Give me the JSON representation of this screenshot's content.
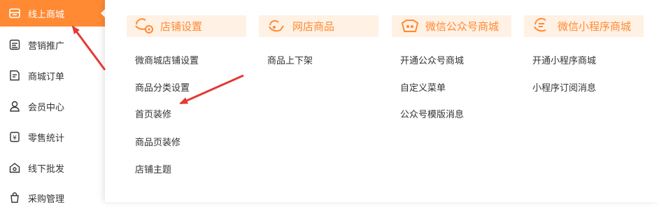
{
  "sidebar": {
    "items": [
      {
        "label": "线上商城",
        "icon": "store-icon",
        "active": true
      },
      {
        "label": "营销推广",
        "icon": "marketing-icon"
      },
      {
        "label": "商城订单",
        "icon": "order-icon"
      },
      {
        "label": "会员中心",
        "icon": "member-icon"
      },
      {
        "label": "零售统计",
        "icon": "statistics-icon"
      },
      {
        "label": "线下批发",
        "icon": "wholesale-icon"
      },
      {
        "label": "采购管理",
        "icon": "purchase-icon"
      }
    ]
  },
  "flyout": {
    "columns": [
      {
        "title": "店铺设置",
        "icon": "shop-settings-icon",
        "links": [
          "微商城店铺设置",
          "商品分类设置",
          "首页装修",
          "商品页装修",
          "店铺主题"
        ]
      },
      {
        "title": "网店商品",
        "icon": "online-goods-icon",
        "links": [
          "商品上下架"
        ]
      },
      {
        "title": "微信公众号商城",
        "icon": "wechat-official-icon",
        "links": [
          "开通公众号商城",
          "自定义菜单",
          "公众号模版消息"
        ]
      },
      {
        "title": "微信小程序商城",
        "icon": "mini-program-icon",
        "links": [
          "开通小程序商城",
          "小程序订阅消息"
        ]
      }
    ]
  },
  "colors": {
    "accent": "#ff8a33",
    "header_bg": "#fff1e4",
    "arrow": "#e53935"
  }
}
